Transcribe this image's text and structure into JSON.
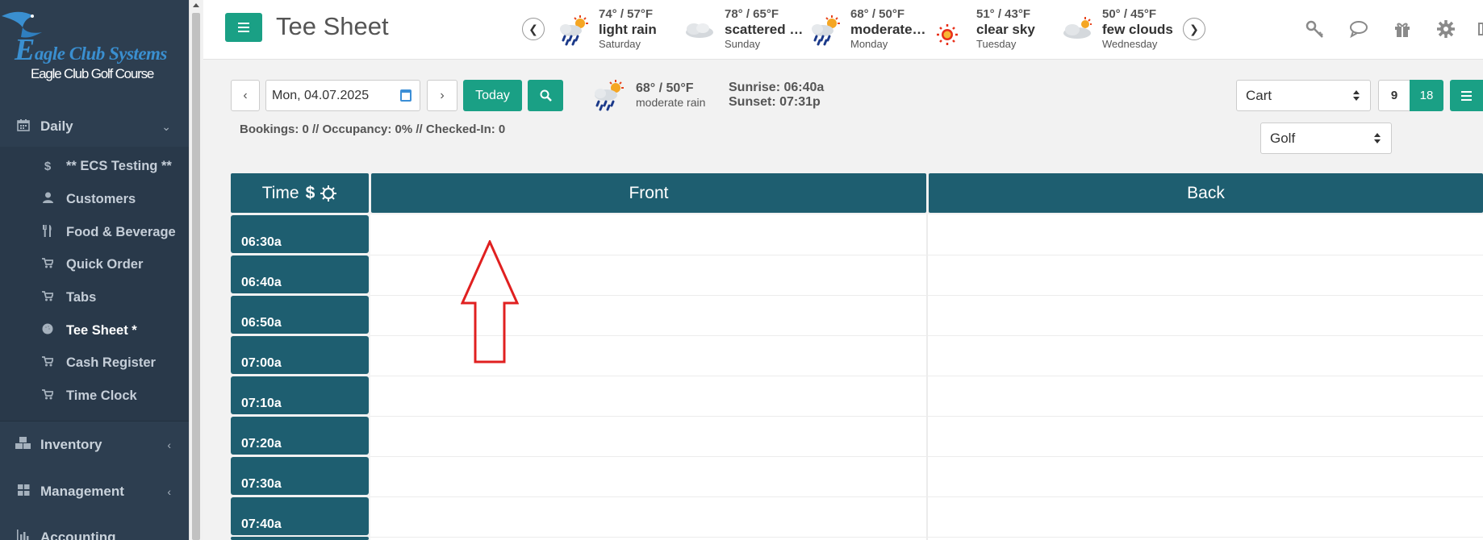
{
  "brand": {
    "logo_rest": "agle Club Systems",
    "logo_initial": "E",
    "course": "Eagle Club Golf Course"
  },
  "sidebar": {
    "groups": [
      {
        "label": "Daily",
        "icon": "calendar-icon"
      },
      {
        "label": "Inventory",
        "icon": "cubes-icon"
      },
      {
        "label": "Management",
        "icon": "grid-icon"
      },
      {
        "label": "Accounting",
        "icon": "bar-chart-icon"
      }
    ],
    "daily_items": [
      {
        "label": "** ECS Testing **",
        "icon": "dollar-icon"
      },
      {
        "label": "Customers",
        "icon": "user-icon"
      },
      {
        "label": "Food & Beverage",
        "icon": "cutlery-icon"
      },
      {
        "label": "Quick Order",
        "icon": "cart-icon"
      },
      {
        "label": "Tabs",
        "icon": "cart-icon"
      },
      {
        "label": "Tee Sheet *",
        "icon": "golf-ball-icon",
        "active": true
      },
      {
        "label": "Cash Register",
        "icon": "cart-icon"
      },
      {
        "label": "Time Clock",
        "icon": "cart-icon"
      }
    ]
  },
  "header": {
    "title": "Tee Sheet"
  },
  "forecast": [
    {
      "temp": "74° / 57°F",
      "desc": "light rain",
      "day": "Saturday",
      "icon": "rain-sun-icon"
    },
    {
      "temp": "78° / 65°F",
      "desc": "scattered c...",
      "day": "Sunday",
      "icon": "cloud-icon"
    },
    {
      "temp": "68° / 50°F",
      "desc": "moderate r...",
      "day": "Monday",
      "icon": "rain-sun-icon"
    },
    {
      "temp": "51° / 43°F",
      "desc": "clear sky",
      "day": "Tuesday",
      "icon": "sun-icon"
    },
    {
      "temp": "50° / 45°F",
      "desc": "few clouds",
      "day": "Wednesday",
      "icon": "cloud-sun-icon"
    }
  ],
  "controls": {
    "date_value": "Mon, 04.07.2025",
    "today_label": "Today",
    "today_weather": {
      "temp": "68° / 50°F",
      "desc": "moderate rain"
    },
    "sunrise": "Sunrise: 06:40a",
    "sunset": "Sunset: 07:31p",
    "stats": "Bookings: 0 // Occupancy: 0% // Checked-In: 0",
    "cart_select": "Cart",
    "golf_select": "Golf",
    "holes_9": "9",
    "holes_18": "18"
  },
  "grid": {
    "time_header": "Time",
    "front_header": "Front",
    "back_header": "Back",
    "times": [
      "06:30a",
      "06:40a",
      "06:50a",
      "07:00a",
      "07:10a",
      "07:20a",
      "07:30a",
      "07:40a"
    ]
  },
  "colors": {
    "accent": "#1aa085",
    "header_teal": "#1e5e70",
    "sidebar": "#2d3e50",
    "annotation": "#e02020"
  }
}
